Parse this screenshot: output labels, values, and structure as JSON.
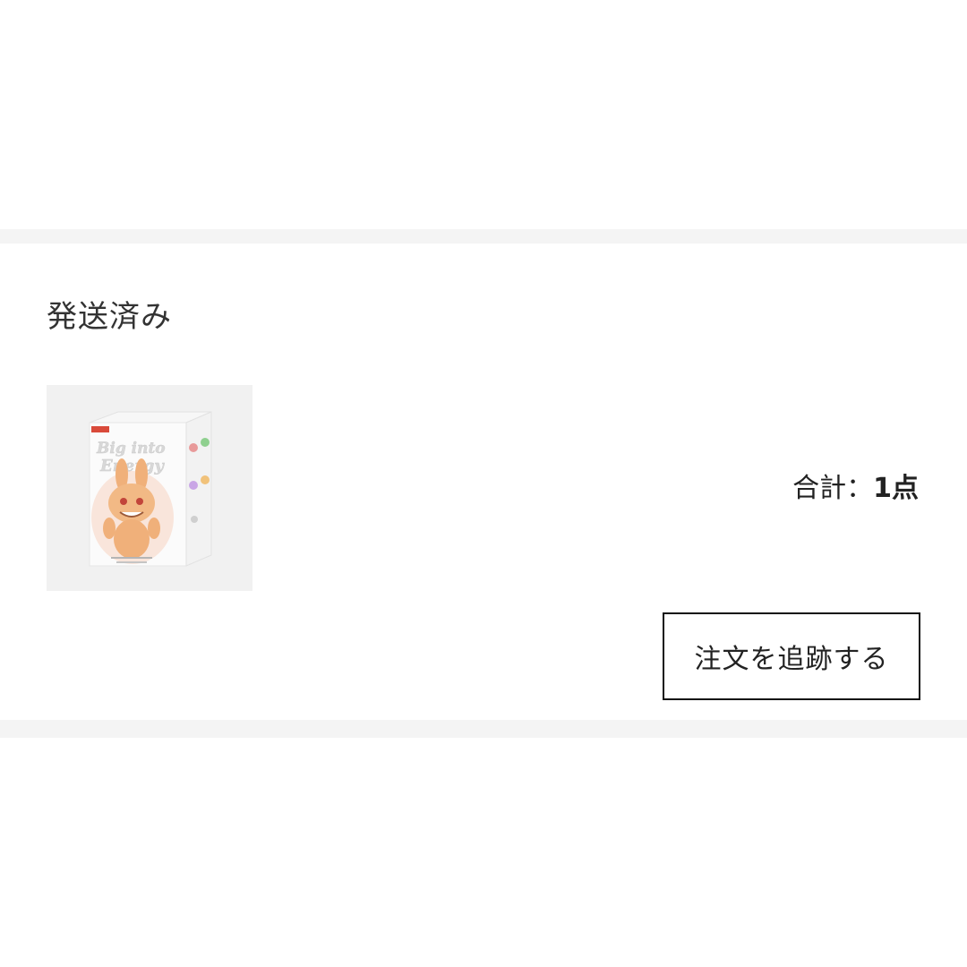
{
  "order": {
    "status": "発送済み",
    "total_label": "合計：",
    "total_count": "1点",
    "track_button_label": "注文を追跡する",
    "product": {
      "box_text_line1": "Big into",
      "box_text_line2": "Energy"
    }
  },
  "colors": {
    "divider": "#f4f4f4",
    "button_border": "#111111",
    "thumb_bg": "#f1f1f1",
    "figure_orange": "#f0b07a"
  }
}
